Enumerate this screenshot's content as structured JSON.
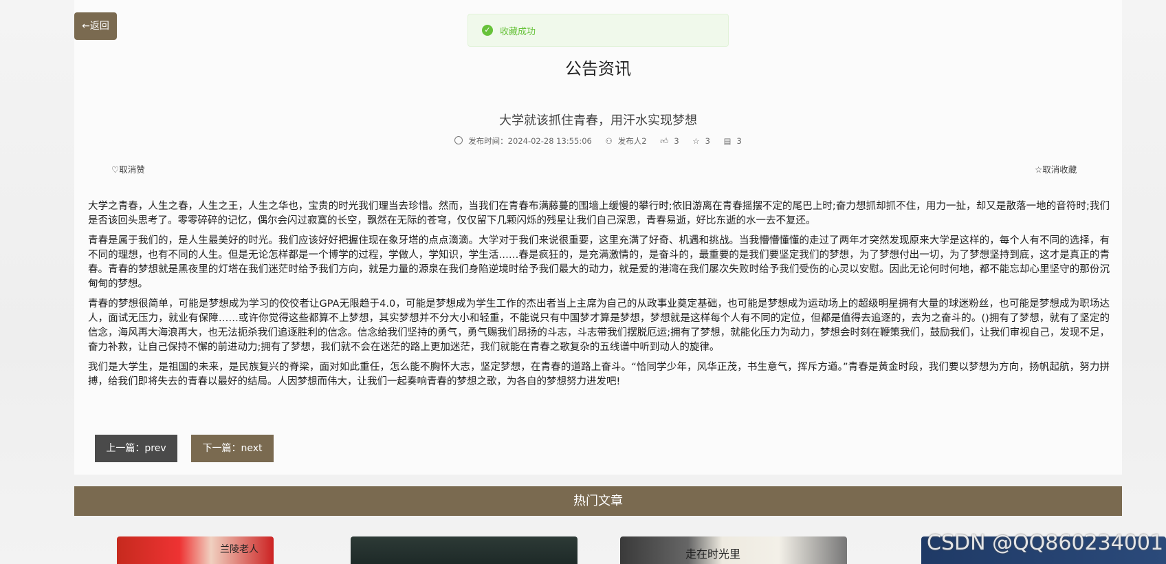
{
  "nav": {
    "back_label": "←返回"
  },
  "toast": {
    "message": "收藏成功",
    "icon": "check-circle-icon"
  },
  "section_title": "公告资讯",
  "article": {
    "title": "大学就该抓住青春，用汗水实现梦想",
    "meta": {
      "time_label": "发布时间：2024-02-28 13:55:06",
      "author": "发布人2",
      "likes": "3",
      "favorites": "3",
      "comments": "3"
    },
    "unlike_label": "取消赞",
    "uncollect_label": "取消收藏",
    "paragraphs": [
      "大学之青春，人生之春，人生之王，人生之华也，宝贵的时光我们理当去珍惜。然而，当我们在青春布满藤蔓的围墙上缓慢的攀行时;依旧游离在青春摇摆不定的尾巴上时;奋力想抓却抓不住，用力一扯，却又是散落一地的音符时;我们是否该回头思考了。零零碎碎的记忆，偶尔会闪过寂寞的长空，飘然在无际的苍穹，仅仅留下几颗闪烁的残星让我们自己深思，青春易逝，好比东逝的水一去不复还。",
      "青春是属于我们的，是人生最美好的时光。我们应该好好把握住现在象牙塔的点点滴滴。大学对于我们来说很重要，这里充满了好奇、机遇和挑战。当我懵懵懂懂的走过了两年才突然发现原来大学是这样的，每个人有不同的选择，有不同的理想，也有不同的人生。但是无论怎样都是一个博学的过程，学做人，学知识，学生活……春是疯狂的，是充满激情的，是奋斗的，最重要的是我们要坚定我们的梦想，为了梦想付出一切，为了梦想坚持到底，这才是真正的青春。青春的梦想就是黑夜里的灯塔在我们迷茫时给予我们方向，就是力量的源泉在我们身陷逆境时给予我们最大的动力，就是爱的港湾在我们屡次失败时给予我们受伤的心灵以安慰。因此无论何时何地，都不能忘却心里坚守的那份沉甸甸的梦想。",
      "青春的梦想很简单，可能是梦想成为学习的佼佼者让GPA无限趋于4.0，可能是梦想成为学生工作的杰出者当上主席为自己的从政事业奠定基础，也可能是梦想成为运动场上的超级明星拥有大量的球迷粉丝，也可能是梦想成为职场达人，面试无压力，就业有保障……或许你觉得这些都算不上梦想，其实梦想并不分大小和轻重，不能说只有中国梦才算是梦想，梦想就是这样每个人有不同的定位，但都是值得去追逐的，去为之奋斗的。()拥有了梦想，就有了坚定的信念，海风再大海浪再大，也无法扼杀我们追逐胜利的信念。信念给我们坚持的勇气，勇气赐我们昂扬的斗志，斗志带我们摆脱厄运;拥有了梦想，就能化压力为动力，梦想会时刻在鞭策我们，鼓励我们，让我们审视自己，发现不足，奋力补救，让自己保持不懈的前进动力;拥有了梦想，我们就不会在迷茫的路上更加迷茫，我们就能在青春之歌复杂的五线谱中听到动人的旋律。",
      "我们是大学生，是祖国的未来，是民族复兴的脊梁，面对如此重任，怎么能不胸怀大志，坚定梦想，在青春的道路上奋斗。“恰同学少年，风华正茂，书生意气，挥斥方遒。”青春是黄金时段，我们要以梦想为方向，扬帆起航，努力拼搏，给我们即将失去的青春以最好的结局。人因梦想而伟大，让我们一起奏响青春的梦想之歌，为各自的梦想努力进发吧!"
    ]
  },
  "pager": {
    "prev_label": "上一篇：prev",
    "next_label": "下一篇：next"
  },
  "hot": {
    "title": "热门文章",
    "thumbs": [
      {
        "caption": "兰陵老人"
      },
      {
        "caption": ""
      },
      {
        "caption": "走在时光里"
      },
      {
        "caption": ""
      }
    ]
  },
  "watermark": "CSDN @QQ860234001"
}
